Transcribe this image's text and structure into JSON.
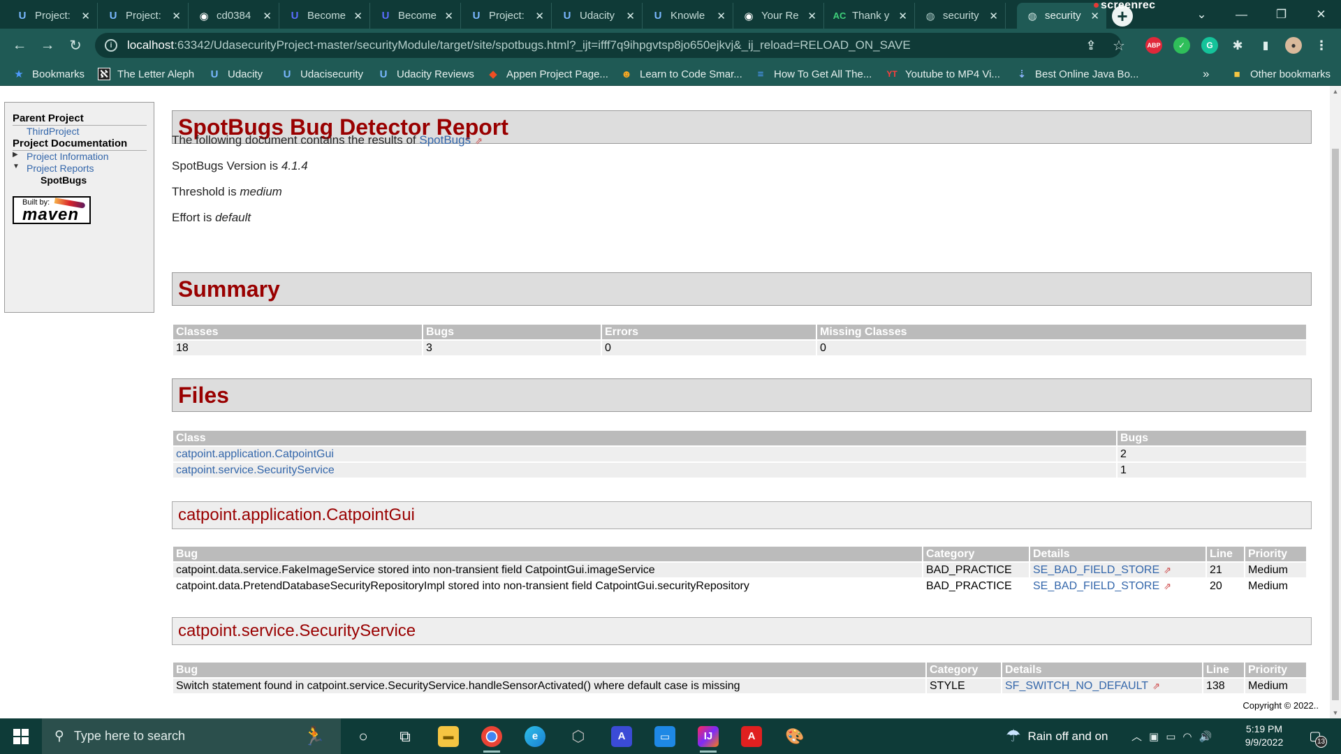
{
  "browser": {
    "tabs": [
      {
        "title": "Project:",
        "icon": "udacity-icon"
      },
      {
        "title": "Project:",
        "icon": "udacity-icon"
      },
      {
        "title": "cd0384",
        "icon": "github-icon"
      },
      {
        "title": "Become",
        "icon": "udacity-icon"
      },
      {
        "title": "Become",
        "icon": "udacity-icon"
      },
      {
        "title": "Project:",
        "icon": "udacity-icon"
      },
      {
        "title": "Udacity",
        "icon": "udacity-icon"
      },
      {
        "title": "Knowle",
        "icon": "udacity-icon"
      },
      {
        "title": "Your Re",
        "icon": "github-icon"
      },
      {
        "title": "Thank y",
        "icon": "ac-icon"
      },
      {
        "title": "security",
        "icon": "globe-icon"
      },
      {
        "title": "security",
        "icon": "globe-icon"
      }
    ],
    "screenrec_label": "screenrec",
    "url_host": "localhost",
    "url_rest": ":63342/UdasecurityProject-master/securityModule/target/site/spotbugs.html?_ijt=ifff7q9ihpgvtsp8jo650ejkvj&_ij_reload=RELOAD_ON_SAVE",
    "bookmarks": [
      {
        "label": "Bookmarks",
        "icon": "star-icon"
      },
      {
        "label": "The Letter Aleph",
        "icon": "aleph-icon"
      },
      {
        "label": "Udacity",
        "icon": "udacity-icon"
      },
      {
        "label": "Udacisecurity",
        "icon": "udacity-icon"
      },
      {
        "label": "Udacity Reviews",
        "icon": "udacity-icon"
      },
      {
        "label": "Appen Project Page...",
        "icon": "appen-icon"
      },
      {
        "label": "Learn to Code Smar...",
        "icon": "code-icon"
      },
      {
        "label": "How To Get All The...",
        "icon": "list-icon"
      },
      {
        "label": "Youtube to MP4 Vi...",
        "icon": "yt-icon"
      },
      {
        "label": "Best Online Java Bo...",
        "icon": "download-icon"
      }
    ],
    "more_bookmarks": "»",
    "other_bookmarks": "Other bookmarks"
  },
  "sidebar": {
    "parent_heading": "Parent Project",
    "parent_link": "ThirdProject",
    "docs_heading": "Project Documentation",
    "project_info": "Project Information",
    "project_reports": "Project Reports",
    "current": "SpotBugs",
    "badge_built_by": "Built by:",
    "badge_maven": "maven"
  },
  "report": {
    "title": "SpotBugs Bug Detector Report",
    "intro_prefix": "The following document contains the results of",
    "intro_link": "SpotBugs",
    "version_prefix": "SpotBugs Version is",
    "version": "4.1.4",
    "threshold_prefix": "Threshold is",
    "threshold": "medium",
    "effort_prefix": "Effort is",
    "effort": "default",
    "summary_heading": "Summary",
    "summary_headers": [
      "Classes",
      "Bugs",
      "Errors",
      "Missing Classes"
    ],
    "summary_values": [
      "18",
      "3",
      "0",
      "0"
    ],
    "files_heading": "Files",
    "files_headers": [
      "Class",
      "Bugs"
    ],
    "files_rows": [
      [
        "catpoint.application.CatpointGui",
        "2"
      ],
      [
        "catpoint.service.SecurityService",
        "1"
      ]
    ],
    "class1": {
      "heading": "catpoint.application.CatpointGui",
      "headers": [
        "Bug",
        "Category",
        "Details",
        "Line",
        "Priority"
      ],
      "rows": [
        [
          "catpoint.data.service.FakeImageService stored into non-transient field CatpointGui.imageService",
          "BAD_PRACTICE",
          "SE_BAD_FIELD_STORE",
          "21",
          "Medium"
        ],
        [
          "catpoint.data.PretendDatabaseSecurityRepositoryImpl stored into non-transient field CatpointGui.securityRepository",
          "BAD_PRACTICE",
          "SE_BAD_FIELD_STORE",
          "20",
          "Medium"
        ]
      ]
    },
    "class2": {
      "heading": "catpoint.service.SecurityService",
      "headers": [
        "Bug",
        "Category",
        "Details",
        "Line",
        "Priority"
      ],
      "rows": [
        [
          "Switch statement found in catpoint.service.SecurityService.handleSensorActivated() where default case is missing",
          "STYLE",
          "SF_SWITCH_NO_DEFAULT",
          "138",
          "Medium"
        ]
      ]
    },
    "copyright": "Copyright © 2022.."
  },
  "taskbar": {
    "search_placeholder": "Type here to search",
    "weather": "Rain off and on",
    "time": "5:19 PM",
    "date": "9/9/2022",
    "notifications": "13"
  },
  "colors": {
    "heading_red": "#990000",
    "link_blue": "#3366aa",
    "tab_bg": "#0f3a37",
    "toolbar_bg": "#1f5a55"
  }
}
